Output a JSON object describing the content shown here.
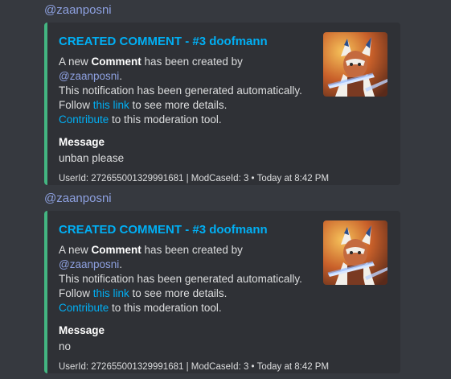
{
  "messages": [
    {
      "mention": "@zaanposni",
      "embed": {
        "title": "CREATED COMMENT - #3 doofmann",
        "desc_prefix": "A new ",
        "desc_bold": "Comment",
        "desc_mid": " has been created by ",
        "desc_mention": "@zaanposni",
        "desc_period": ".",
        "line2": "This notification has been generated automatically.",
        "line3_prefix": "Follow ",
        "line3_link": "this link",
        "line3_suffix": " to see more details.",
        "line4_link": "Contribute",
        "line4_suffix": " to this moderation tool.",
        "field_name": "Message",
        "field_value": "unban please",
        "footer": "UserId: 272655001329991681 | ModCaseId: 3 • Today at 8:42 PM"
      }
    },
    {
      "mention": "@zaanposni",
      "embed": {
        "title": "CREATED COMMENT - #3 doofmann",
        "desc_prefix": "A new ",
        "desc_bold": "Comment",
        "desc_mid": " has been created by ",
        "desc_mention": "@zaanposni",
        "desc_period": ".",
        "line2": "This notification has been generated automatically.",
        "line3_prefix": "Follow ",
        "line3_link": "this link",
        "line3_suffix": " to see more details.",
        "line4_link": "Contribute",
        "line4_suffix": " to this moderation tool.",
        "field_name": "Message",
        "field_value": "no",
        "footer": "UserId: 272655001329991681 | ModCaseId: 3 • Today at 8:42 PM"
      }
    }
  ],
  "colors": {
    "background": "#36393f",
    "embed_bg": "#2f3136",
    "embed_border": "#43b581",
    "link": "#00aff4",
    "mention": "#8ea1e1"
  },
  "icons": {
    "thumbnail": "ahsoka-avatar-image"
  }
}
